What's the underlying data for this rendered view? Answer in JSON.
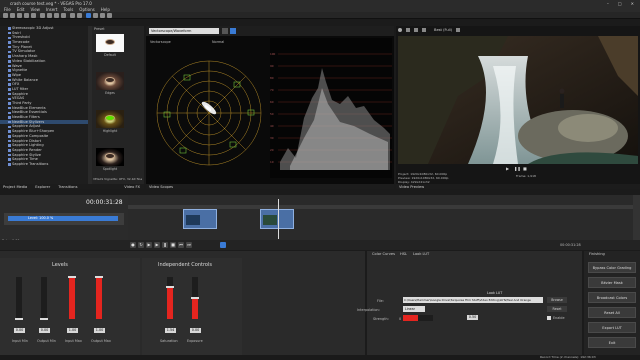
{
  "app": {
    "title": "crash course test.veg * - VEGAS Pro 17.0"
  },
  "menu": [
    "File",
    "Edit",
    "View",
    "Insert",
    "Tools",
    "Options",
    "Help"
  ],
  "fx_list": [
    "Stereoscopic 3D Adjust",
    "Swirl",
    "Threshold",
    "Timecode",
    "Tiny Planet",
    "TV Simulator",
    "Unsharp Mask",
    "Video Stabilization",
    "Wave",
    "Vignette",
    "Wipe",
    "White Balance",
    "OFX",
    "LUT filter",
    "Sapphire",
    "VEGAS",
    "Third Party",
    "NewBlue Elements",
    "NewBlue Essentials",
    "NewBlue Filters",
    "NewBlue Stylizers",
    "Sapphire Adjust",
    "Sapphire Blur+Sharpen",
    "Sapphire Composite",
    "Sapphire Distort",
    "Sapphire Lighting",
    "Sapphire Render",
    "Sapphire Stylize",
    "Sapphire Time",
    "Sapphire Transitions"
  ],
  "fx_selected_index": 20,
  "presets": {
    "header": "Preset",
    "items": [
      {
        "label": "Default"
      },
      {
        "label": "Edges"
      },
      {
        "label": "Highlight"
      },
      {
        "label": "Spotlight"
      }
    ],
    "footer": "VEGAS Vignette: OFX, 32-bit floa"
  },
  "left_tabs": [
    "Project Media",
    "Explorer",
    "Transitions"
  ],
  "left_tabs_right": [
    "Video FX"
  ],
  "scopes": {
    "dropdown": "Vectorscope/Waveform",
    "vectorscope_label": "Vectorscope",
    "normal_label": "Normal",
    "waveform_label": "Waveform",
    "luminance_label": "Luminance",
    "tab": "Video Scopes",
    "waveform_scale": [
      "100",
      "90",
      "80",
      "70",
      "60",
      "50",
      "40",
      "30",
      "20",
      "10",
      "0"
    ]
  },
  "preview": {
    "mode": "Best (Full)",
    "project": "Project: 1920x1080x32, 60.000p",
    "preview_res": "Preview: 1920x1080x32, 60.000p",
    "display": "Display: 429x241x32",
    "frame": "Frame: 1,918",
    "tab": "Video Preview"
  },
  "timeline": {
    "timecode": "00:00:31:28",
    "track_level": "Level: 100.0 %",
    "rate": "Rate: 0.00",
    "end_time": "00:00:31:28"
  },
  "bottom_tabs_left": [
    "Input LUT",
    "Color Wheels",
    "Color Channels",
    "Input/Output"
  ],
  "bottom_tabs_mid": [
    "Color Curves",
    "HSL",
    "Look LUT"
  ],
  "bottom_tab_right": "Finishing",
  "levels": {
    "title": "Levels",
    "sliders": [
      {
        "label": "Input Min",
        "value": "0.00",
        "level": 0.0
      },
      {
        "label": "Output Min",
        "value": "0.00",
        "level": 0.0
      },
      {
        "label": "Input Max",
        "value": "1.00",
        "level": 1.0
      },
      {
        "label": "Output Max",
        "value": "1.00",
        "level": 1.0
      }
    ]
  },
  "independent": {
    "title": "Independent Controls",
    "sliders": [
      {
        "label": "Saturation",
        "value": "1.54",
        "level": 0.77
      },
      {
        "label": "Exposure",
        "value": "0.00",
        "level": 0.5
      }
    ]
  },
  "look_lut": {
    "title": "Look LUT",
    "file_label": "File:",
    "file_value": "C:\\Users\\Hammer\\Google Drive\\Turquoise Film Stuff\\Video Editing\\LUTs\\Teal And Orange",
    "browse": "Browse",
    "interp_label": "Interpolation:",
    "interp_value": "Linear",
    "reset": "Reset",
    "strength_label": "Strength:",
    "strength_min": "0",
    "strength_value": "0.50",
    "strength_level": 0.5,
    "enable": "Enable"
  },
  "finishing_buttons": [
    "Bypass Color Grading",
    "Bézier Mask",
    "Broadcast Colors",
    "Reset All",
    "Export LUT",
    "Exit"
  ],
  "status": "Record Time (2 channels): 192:36:03",
  "colors": {
    "accent": "#3a7bd5",
    "red": "#e4251f",
    "selected": "#2e4a6e"
  }
}
